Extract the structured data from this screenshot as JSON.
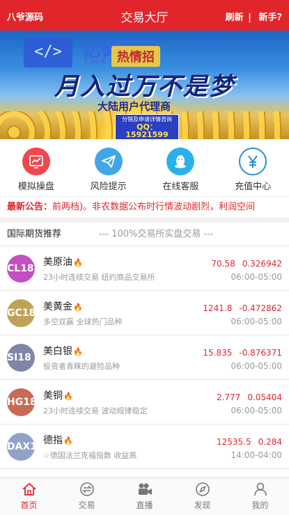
{
  "header": {
    "left_label": "八爷源码",
    "title": "交易大厅",
    "refresh_label": "刷新",
    "separator": "|",
    "newbie_label": "新手?"
  },
  "banner": {
    "logo_text": "亿码酷站",
    "logo_sub": "YMKUZHAN",
    "promo": "热情招",
    "slogan": "月入过万不是梦",
    "sub_slogan": "大陆用户代理商",
    "contact_line": "分销及申请详情咨询",
    "qq": "QQ：15921599"
  },
  "menu": {
    "items": [
      {
        "label": "模拟操盘",
        "icon": "chart-icon",
        "color": "#f0474d"
      },
      {
        "label": "风险提示",
        "icon": "paper-plane-icon",
        "color": "#41a6e8"
      },
      {
        "label": "在线客服",
        "icon": "qq-penguin-icon",
        "color": "#2bb1ea"
      },
      {
        "label": "充值中心",
        "icon": "yen-icon",
        "color": "#2a8fcf"
      }
    ]
  },
  "notice": {
    "label": "最新公告：",
    "text": "前两档)。非农数据公布时行情波动剧烈，利润空间"
  },
  "section": {
    "title": "国际期货推荐",
    "subtitle": "--- 100%交易所实盘交易 ---"
  },
  "products": [
    {
      "code": "CL18",
      "name": "美原油",
      "desc": "23小时连续交易 纽约商品交易所",
      "price": "70.58",
      "change": "0.326942",
      "hours": "06:00-05:00",
      "avatar_color": "#c44fc0"
    },
    {
      "code": "GC18",
      "name": "美黄金",
      "desc": "多空双赢 全球热门品种",
      "price": "1241.8",
      "change": "-0.472862",
      "hours": "06:00-05:00",
      "avatar_color": "#c0a159"
    },
    {
      "code": "SI18",
      "name": "美白银",
      "desc": "投资者青睐的避险品种",
      "price": "15.835",
      "change": "-0.876371",
      "hours": "06:00-05:00",
      "avatar_color": "#7f86a8"
    },
    {
      "code": "HG18",
      "name": "美铜",
      "desc": "23小时连续交易 波动规律稳定",
      "price": "2.777",
      "change": "0.05404",
      "hours": "06:00-05:00",
      "avatar_color": "#c96a56"
    },
    {
      "code": "DAX1",
      "name": "德指",
      "desc": "☆德国法兰克福指数 收益高",
      "price": "12535.5",
      "change": "0.284",
      "hours": "14:00-04:00",
      "avatar_color": "#8fa3c9"
    }
  ],
  "tabbar": {
    "items": [
      {
        "label": "首页",
        "icon": "home-icon",
        "active": true
      },
      {
        "label": "交易",
        "icon": "exchange-icon",
        "active": false
      },
      {
        "label": "直播",
        "icon": "video-camera-icon",
        "active": false
      },
      {
        "label": "发现",
        "icon": "compass-icon",
        "active": false
      },
      {
        "label": "我的",
        "icon": "user-icon",
        "active": false
      }
    ]
  },
  "colors": {
    "primary": "#e0262b",
    "flame": "#ff7a1a"
  }
}
